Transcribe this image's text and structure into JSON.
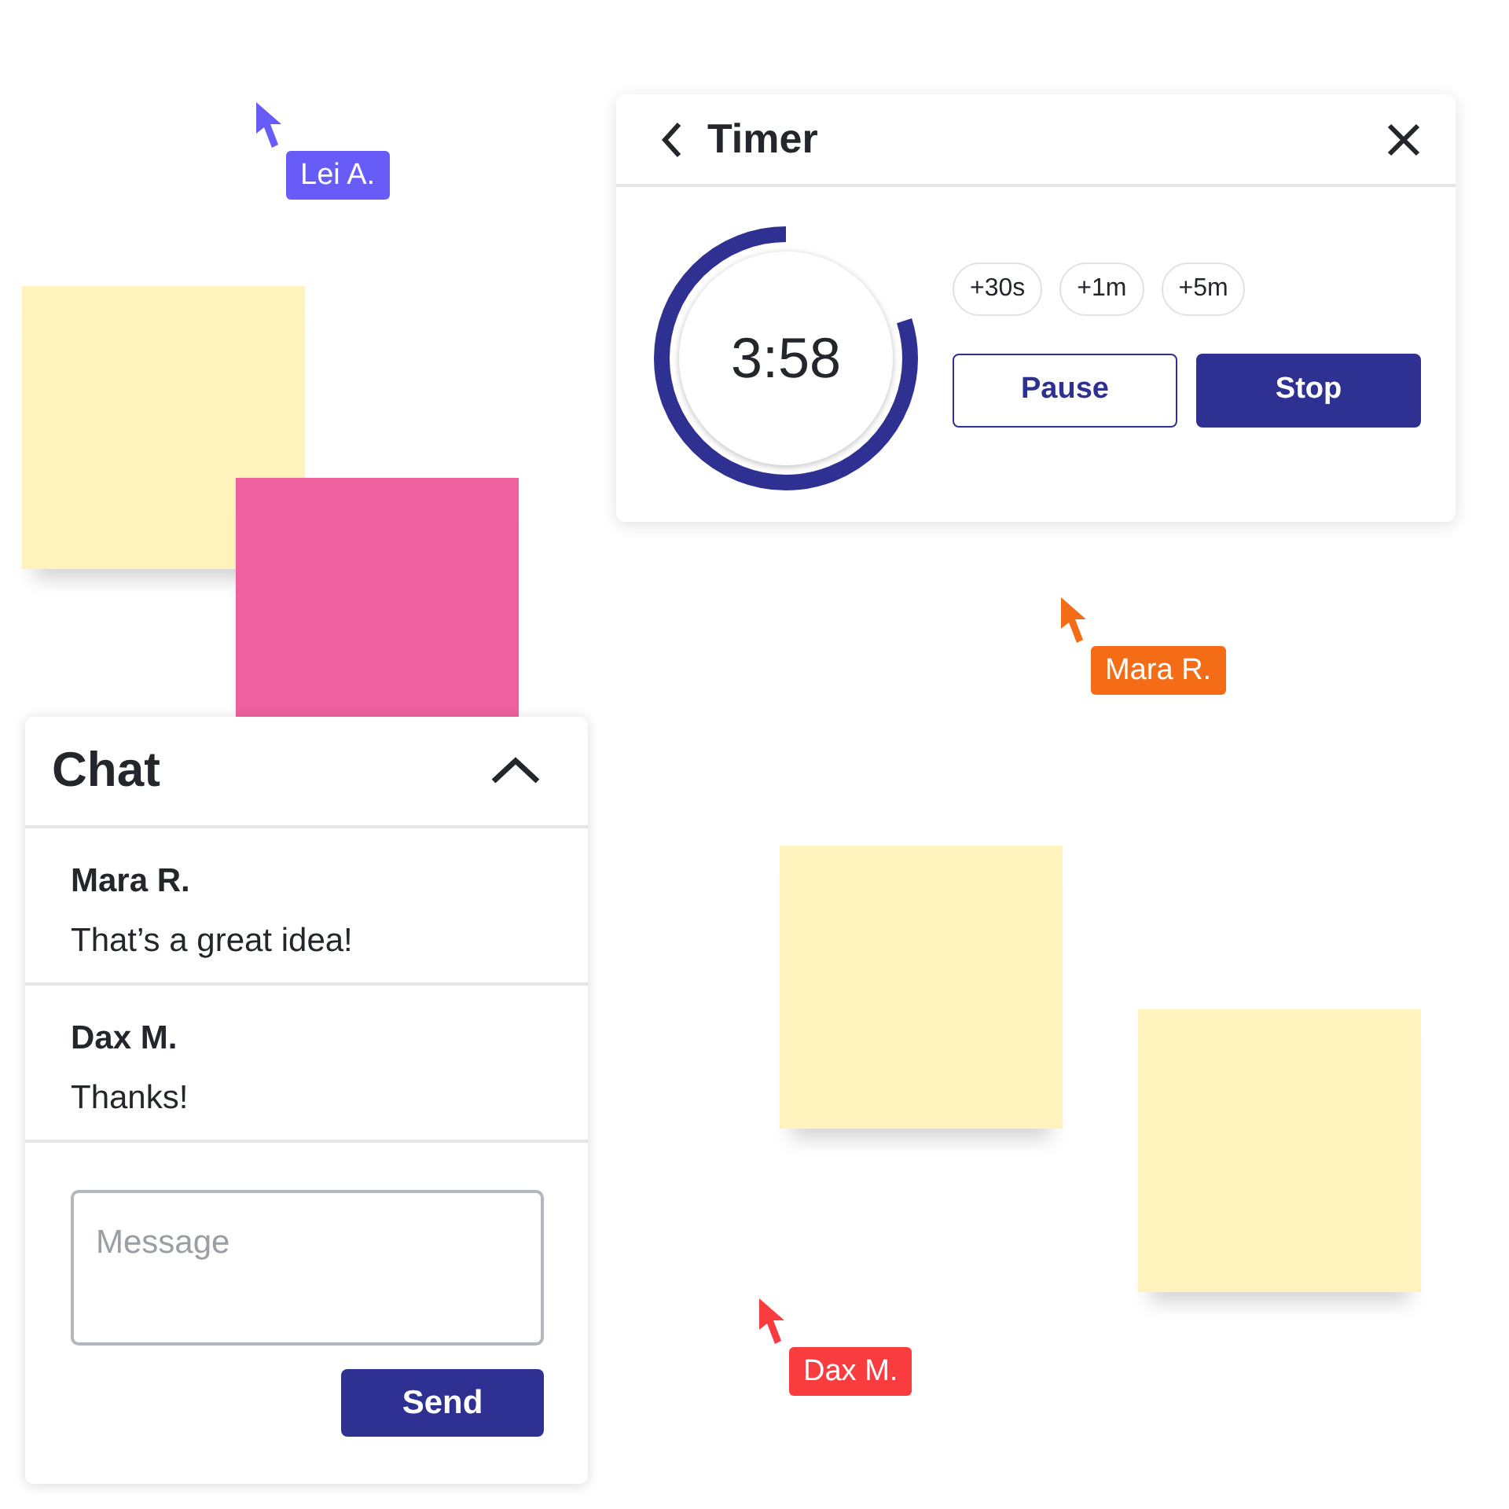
{
  "cursors": [
    {
      "name": "Lei A.",
      "color": "#675cf7"
    },
    {
      "name": "Mara R.",
      "color": "#f46c15"
    },
    {
      "name": "Dax M.",
      "color": "#f93c3e"
    }
  ],
  "sticky_notes": [
    {
      "color": "#fef3bd"
    },
    {
      "color": "#ef619e"
    },
    {
      "color": "#fef3bd"
    },
    {
      "color": "#fef3bd"
    }
  ],
  "timer": {
    "title": "Timer",
    "time": "3:58",
    "level": 0.8,
    "increments": [
      "+30s",
      "+1m",
      "+5m"
    ],
    "buttons": [
      {
        "label": "Pause",
        "kind": "outline"
      },
      {
        "label": "Stop",
        "kind": "solid"
      }
    ]
  },
  "chat": {
    "title": "Chat",
    "expanded": true,
    "messages": [
      {
        "author": "Mara R.",
        "text": "That’s a great idea!"
      },
      {
        "author": "Dax M.",
        "text": "Thanks!"
      }
    ],
    "input": {
      "placeholder": "Message"
    },
    "send_button": "Send"
  }
}
